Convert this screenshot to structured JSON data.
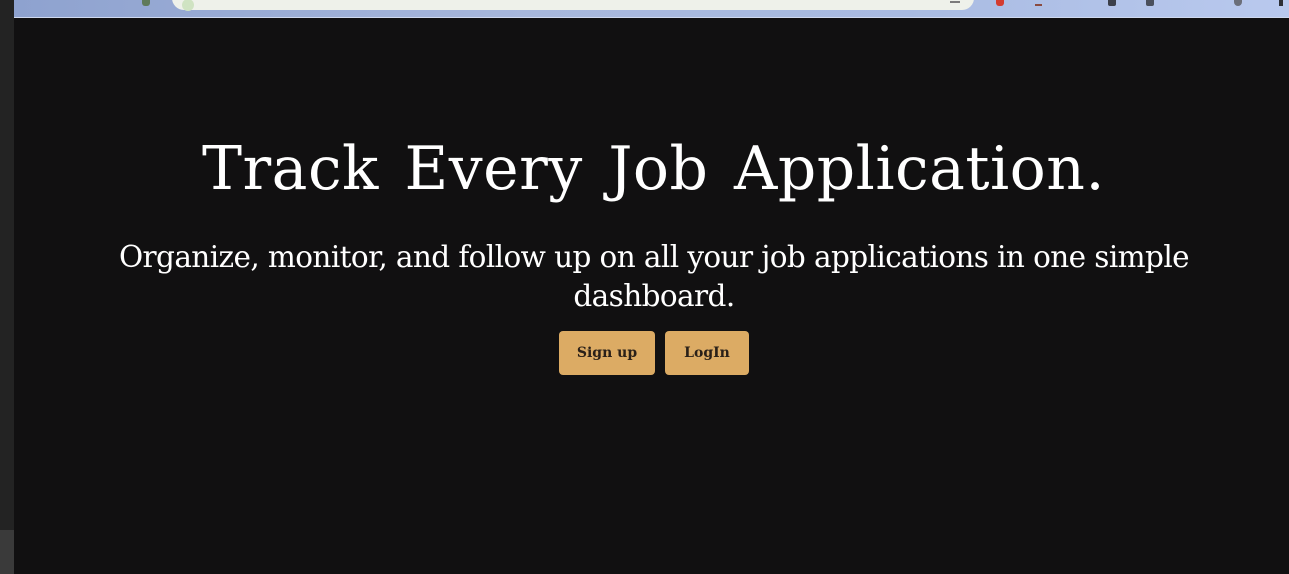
{
  "hero": {
    "title": "Track Every Job Application.",
    "subtitle": "Organize, monitor, and follow up on all your job applications in one simple dashboard.",
    "buttons": {
      "signup_label": "Sign up",
      "login_label": "LogIn"
    }
  },
  "theme": {
    "background": "#111011",
    "text": "#ffffff",
    "accent": "#dcab64",
    "button_text": "#2a2018"
  }
}
